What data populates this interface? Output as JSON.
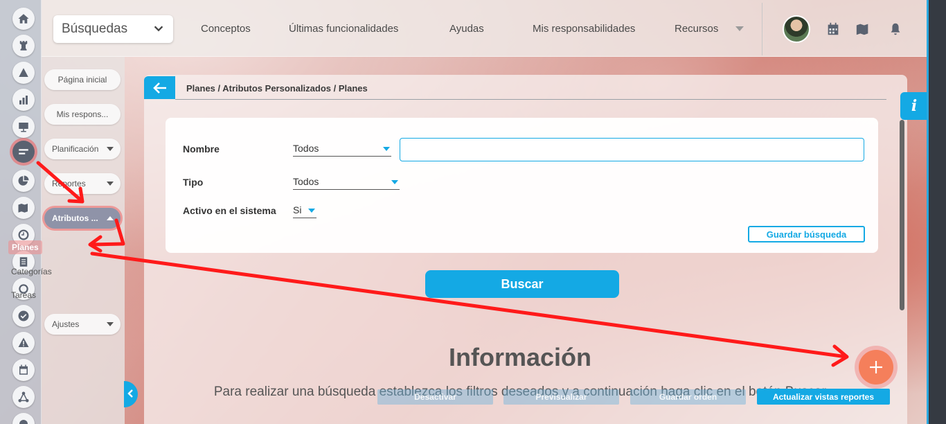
{
  "topbar": {
    "search_select": "Búsquedas",
    "nav": [
      "Conceptos",
      "Últimas funcionalidades",
      "Ayudas",
      "Mis responsabilidades",
      "Recursos"
    ],
    "icons": [
      "avatar",
      "calendar-icon",
      "folder-map-icon",
      "bell-icon"
    ]
  },
  "rail": {
    "icons": [
      "home-icon",
      "chess-rook-icon",
      "pyramid-icon",
      "bar-chart-icon",
      "presentation-icon",
      "plans-icon",
      "pie-chart-icon",
      "map-icon",
      "clock-icon",
      "document-icon",
      "cycle-icon",
      "check-icon",
      "warning-icon",
      "calendar-icon",
      "share-icon",
      "settings-icon"
    ],
    "active": "plans-icon"
  },
  "leftnav": {
    "items": [
      {
        "label": "Página inicial"
      },
      {
        "label": "Mis respons..."
      },
      {
        "label": "Planificación"
      },
      {
        "label": "Reportes"
      },
      {
        "label": "Atributos ..."
      }
    ],
    "subitems": [
      "Planes",
      "Categorías",
      "Tareas"
    ],
    "settings": "Ajustes"
  },
  "breadcrumb": "Planes / Atributos Personalizados / Planes",
  "filters": {
    "nombre_label": "Nombre",
    "nombre_value": "Todos",
    "tipo_label": "Tipo",
    "tipo_value": "Todos",
    "activo_label": "Activo en el sistema",
    "activo_value": "Si",
    "save_search": "Guardar búsqueda",
    "text_value": ""
  },
  "buscar": "Buscar",
  "info": {
    "title": "Información",
    "text": "Para realizar una búsqueda establezca los filtros deseados y a continuación haga clic en el botón Buscar."
  },
  "footer_buttons": {
    "desactivar": "Desactivar",
    "previsualizar": "Previsualizar",
    "guardar_orden": "Guardar orden",
    "actualizar": "Actualizar vistas reportes"
  },
  "colors": {
    "accent": "#14a9e4",
    "fab": "#f57f5b",
    "annotation": "#ff1a1a"
  }
}
